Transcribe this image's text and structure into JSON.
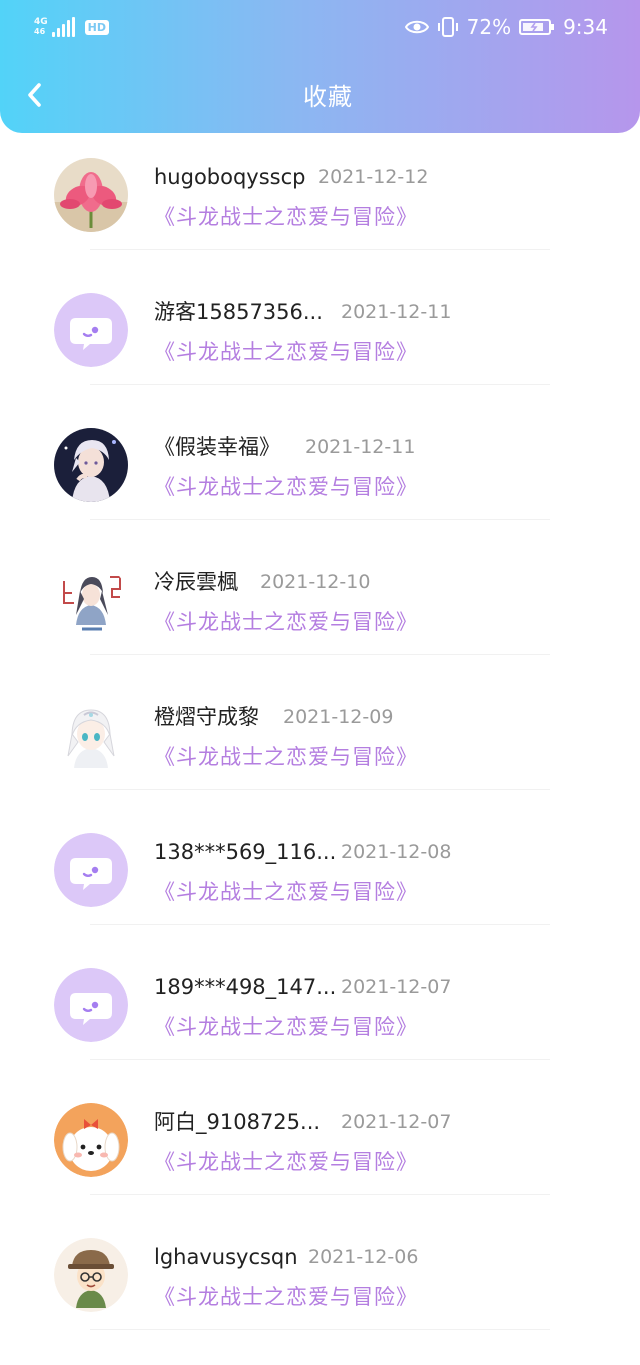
{
  "status_bar": {
    "network": "4G",
    "network_sub": "46",
    "hd": "HD",
    "battery_percent": "72%",
    "time": "9:34",
    "icons": [
      "eye-icon",
      "vibrate-icon",
      "battery-icon"
    ]
  },
  "header": {
    "title": "收藏",
    "back_icon": "chevron-left-icon"
  },
  "colors": {
    "header_gradient_start": "#52d3f8",
    "header_gradient_end": "#b696ec",
    "work_title": "#b47ee0",
    "date": "#9a9a9a",
    "username": "#222222",
    "default_avatar_bg": "#dcc8f8",
    "default_avatar_fg": "#a57ef0"
  },
  "favorites": [
    {
      "username": "hugoboqysscp",
      "date": "2021-12-12",
      "title": "《斗龙战士之恋爱与冒险》",
      "avatar": "lotus-avatar"
    },
    {
      "username": "游客15857356...",
      "date": "2021-12-11",
      "title": "《斗龙战士之恋爱与冒险》",
      "avatar": "default-chat-avatar"
    },
    {
      "username": "《假装幸福》",
      "date": "2021-12-11",
      "title": "《斗龙战士之恋爱与冒险》",
      "avatar": "anime-boy-avatar"
    },
    {
      "username": "冷辰雲楓",
      "date": "2021-12-10",
      "title": "《斗龙战士之恋爱与冒险》",
      "avatar": "anime-ancient-avatar"
    },
    {
      "username": "橙熠守成黎",
      "date": "2021-12-09",
      "title": "《斗龙战士之恋爱与冒险》",
      "avatar": "anime-girl-avatar"
    },
    {
      "username": "138***569_116...",
      "date": "2021-12-08",
      "title": "《斗龙战士之恋爱与冒险》",
      "avatar": "default-chat-avatar"
    },
    {
      "username": "189***498_147...",
      "date": "2021-12-07",
      "title": "《斗龙战士之恋爱与冒险》",
      "avatar": "default-chat-avatar"
    },
    {
      "username": "阿白_9108725...",
      "date": "2021-12-07",
      "title": "《斗龙战士之恋爱与冒险》",
      "avatar": "puppy-avatar"
    },
    {
      "username": "lghavusycsqn",
      "date": "2021-12-06",
      "title": "《斗龙战士之恋爱与冒险》",
      "avatar": "cartoon-boy-avatar"
    }
  ]
}
